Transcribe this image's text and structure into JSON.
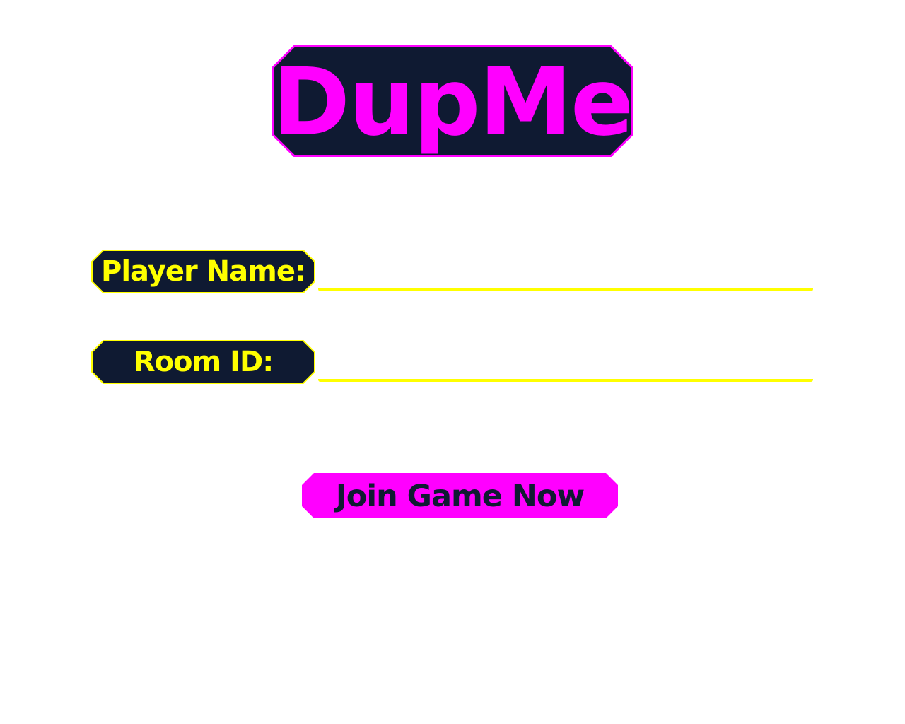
{
  "app": {
    "title": "DupMe"
  },
  "form": {
    "player_name_label": "Player Name:",
    "player_name_value": "",
    "room_id_label": "Room ID:",
    "room_id_value": "",
    "join_button_label": "Join Game Now"
  },
  "colors": {
    "navy": "#0f1a32",
    "magenta": "#ff00ff",
    "yellow": "#ffff00",
    "background": "#ffffff"
  }
}
